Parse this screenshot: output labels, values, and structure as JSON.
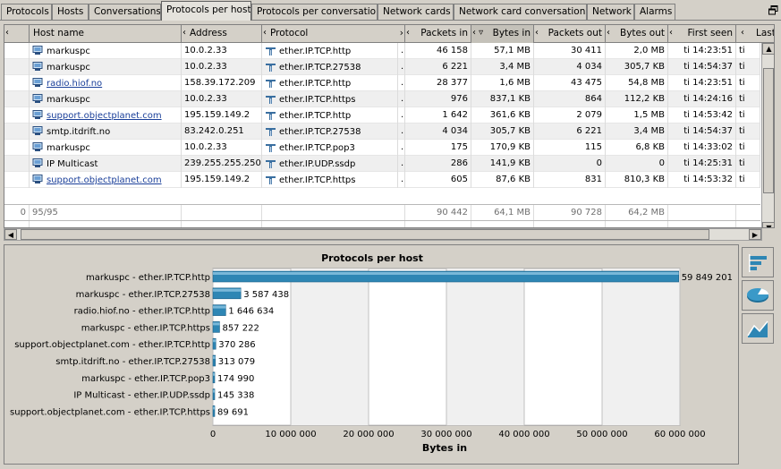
{
  "tabs": [
    {
      "label": "Protocols",
      "active": false
    },
    {
      "label": "Hosts",
      "active": false
    },
    {
      "label": "Conversations",
      "active": false
    },
    {
      "label": "Protocols per host",
      "active": true
    },
    {
      "label": "Protocols per conversation",
      "active": false
    },
    {
      "label": "Network cards",
      "active": false
    },
    {
      "label": "Network card conversations",
      "active": false
    },
    {
      "label": "Network",
      "active": false
    },
    {
      "label": "Alarms",
      "active": false
    }
  ],
  "table": {
    "columns": [
      "Host name",
      "Address",
      "Protocol",
      "Packets in",
      "Bytes in",
      "Packets out",
      "Bytes out",
      "First seen",
      "Last"
    ],
    "rows": [
      {
        "host": "markuspc",
        "link": false,
        "address": "10.0.2.33",
        "protocol": "ether.IP.TCP.http",
        "dots": "..",
        "packets_in": "46 158",
        "bytes_in": "57,1 MB",
        "packets_out": "30 411",
        "bytes_out": "2,0 MB",
        "first_seen": "ti 14:23:51",
        "last": "ti"
      },
      {
        "host": "markuspc",
        "link": false,
        "address": "10.0.2.33",
        "protocol": "ether.IP.TCP.27538",
        "dots": "..",
        "packets_in": "6 221",
        "bytes_in": "3,4 MB",
        "packets_out": "4 034",
        "bytes_out": "305,7 KB",
        "first_seen": "ti 14:54:37",
        "last": "ti"
      },
      {
        "host": "radio.hiof.no",
        "link": true,
        "address": "158.39.172.209",
        "protocol": "ether.IP.TCP.http",
        "dots": "..",
        "packets_in": "28 377",
        "bytes_in": "1,6 MB",
        "packets_out": "43 475",
        "bytes_out": "54,8 MB",
        "first_seen": "ti 14:23:51",
        "last": "ti"
      },
      {
        "host": "markuspc",
        "link": false,
        "address": "10.0.2.33",
        "protocol": "ether.IP.TCP.https",
        "dots": "..",
        "packets_in": "976",
        "bytes_in": "837,1 KB",
        "packets_out": "864",
        "bytes_out": "112,2 KB",
        "first_seen": "ti 14:24:16",
        "last": "ti"
      },
      {
        "host": "support.objectplanet.com",
        "link": true,
        "address": "195.159.149.2",
        "protocol": "ether.IP.TCP.http",
        "dots": "..",
        "packets_in": "1 642",
        "bytes_in": "361,6 KB",
        "packets_out": "2 079",
        "bytes_out": "1,5 MB",
        "first_seen": "ti 14:53:42",
        "last": "ti"
      },
      {
        "host": "smtp.itdrift.no",
        "link": false,
        "address": "83.242.0.251",
        "protocol": "ether.IP.TCP.27538",
        "dots": "..",
        "packets_in": "4 034",
        "bytes_in": "305,7 KB",
        "packets_out": "6 221",
        "bytes_out": "3,4 MB",
        "first_seen": "ti 14:54:37",
        "last": "ti"
      },
      {
        "host": "markuspc",
        "link": false,
        "address": "10.0.2.33",
        "protocol": "ether.IP.TCP.pop3",
        "dots": "..",
        "packets_in": "175",
        "bytes_in": "170,9 KB",
        "packets_out": "115",
        "bytes_out": "6,8 KB",
        "first_seen": "ti 14:33:02",
        "last": "ti"
      },
      {
        "host": "IP Multicast",
        "link": false,
        "address": "239.255.255.250",
        "protocol": "ether.IP.UDP.ssdp",
        "dots": "..",
        "packets_in": "286",
        "bytes_in": "141,9 KB",
        "packets_out": "0",
        "bytes_out": "0",
        "first_seen": "ti 14:25:31",
        "last": "ti"
      },
      {
        "host": "support.objectplanet.com",
        "link": true,
        "address": "195.159.149.2",
        "protocol": "ether.IP.TCP.https",
        "dots": "..",
        "packets_in": "605",
        "bytes_in": "87,6 KB",
        "packets_out": "831",
        "bytes_out": "810,3 KB",
        "first_seen": "ti 14:53:32",
        "last": "ti"
      }
    ],
    "summary": {
      "index": "0",
      "count": "95/95",
      "packets_in": "90 442",
      "bytes_in": "64,1 MB",
      "packets_out": "90 728",
      "bytes_out": "64,2 MB"
    }
  },
  "chart_data": {
    "type": "bar",
    "orientation": "horizontal",
    "title": "Protocols per host",
    "xlabel": "Bytes in",
    "categories": [
      "markuspc - ether.IP.TCP.http",
      "markuspc - ether.IP.TCP.27538",
      "radio.hiof.no - ether.IP.TCP.http",
      "markuspc - ether.IP.TCP.https",
      "support.objectplanet.com - ether.IP.TCP.http",
      "smtp.itdrift.no - ether.IP.TCP.27538",
      "markuspc - ether.IP.TCP.pop3",
      "IP Multicast - ether.IP.UDP.ssdp",
      "support.objectplanet.com - ether.IP.TCP.https"
    ],
    "values": [
      59849201,
      3587438,
      1646634,
      857222,
      370286,
      313079,
      174990,
      145338,
      89691
    ],
    "value_labels": [
      "59 849 201",
      "3 587 438",
      "1 646 634",
      "857 222",
      "370 286",
      "313 079",
      "174 990",
      "145 338",
      "89 691"
    ],
    "xlim": [
      0,
      60000000
    ],
    "ticks": [
      0,
      10000000,
      20000000,
      30000000,
      40000000,
      50000000,
      60000000
    ],
    "tick_labels": [
      "0",
      "10 000 000",
      "20 000 000",
      "30 000 000",
      "40 000 000",
      "50 000 000",
      "60 000 000"
    ],
    "bar_color": "#2e86b4",
    "grid": true
  },
  "side_buttons": [
    "bar-chart-icon",
    "pie-chart-icon",
    "line-chart-icon"
  ]
}
